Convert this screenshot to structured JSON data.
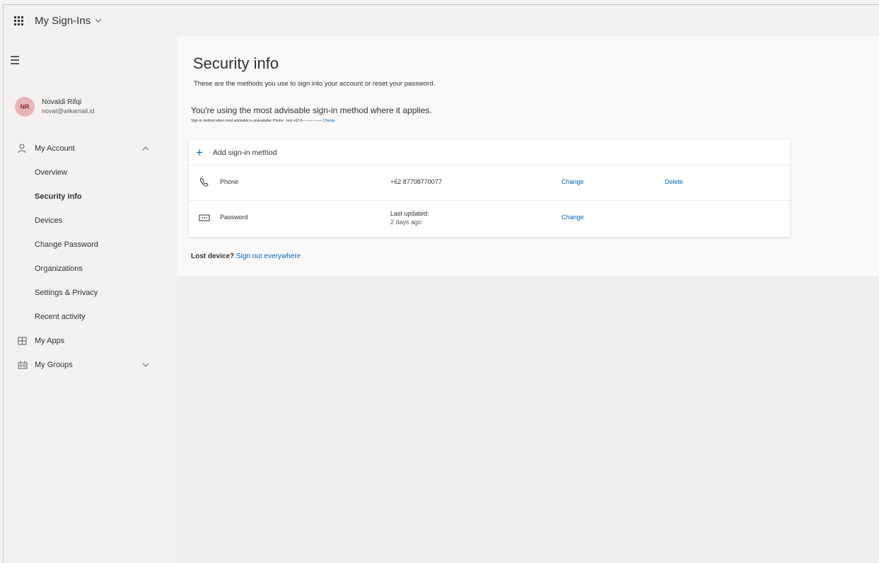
{
  "header": {
    "app_title": "My Sign-Ins",
    "chevron": "⌵"
  },
  "profile": {
    "initials": "NR",
    "name": "Novaldi Rifqi",
    "email": "noval@wikamail.id",
    "avatar_color": "#e8b5b8"
  },
  "sidebar": {
    "items": [
      {
        "label": "My Account",
        "icon": "person-icon",
        "expanded": true
      },
      {
        "label": "Overview"
      },
      {
        "label": "Security info",
        "active": true
      },
      {
        "label": "Devices"
      },
      {
        "label": "Change Password"
      },
      {
        "label": "Organizations"
      },
      {
        "label": "Settings & Privacy"
      },
      {
        "label": "Recent activity"
      },
      {
        "label": "My Apps",
        "icon": "apps-icon"
      },
      {
        "label": "My Groups",
        "icon": "groups-icon",
        "expanded": false
      }
    ]
  },
  "main": {
    "title": "Security info",
    "subtitle": "These are the methods you use to sign into your account or reset your password.",
    "advisable": "You're using the most advisable sign-in method where it applies.",
    "fallback_text": "Sign-in method when most advisable is unavailable: Phone - text +62 8— —— —— ",
    "fallback_link": "Change",
    "add_method": "Add sign-in method",
    "methods": [
      {
        "icon": "phone-icon",
        "label": "Phone",
        "value": "+62 87708770077",
        "change": "Change",
        "delete": "Delete"
      },
      {
        "icon": "password-icon",
        "label": "Password",
        "value_line1": "Last updated:",
        "value_line2": "2 days ago",
        "change": "Change"
      }
    ],
    "lost_device_bold": "Lost device?",
    "lost_device_link": "Sign out everywhere"
  },
  "colors": {
    "accent": "#0067b8",
    "background": "#f3f2f1",
    "card": "#ffffff"
  }
}
